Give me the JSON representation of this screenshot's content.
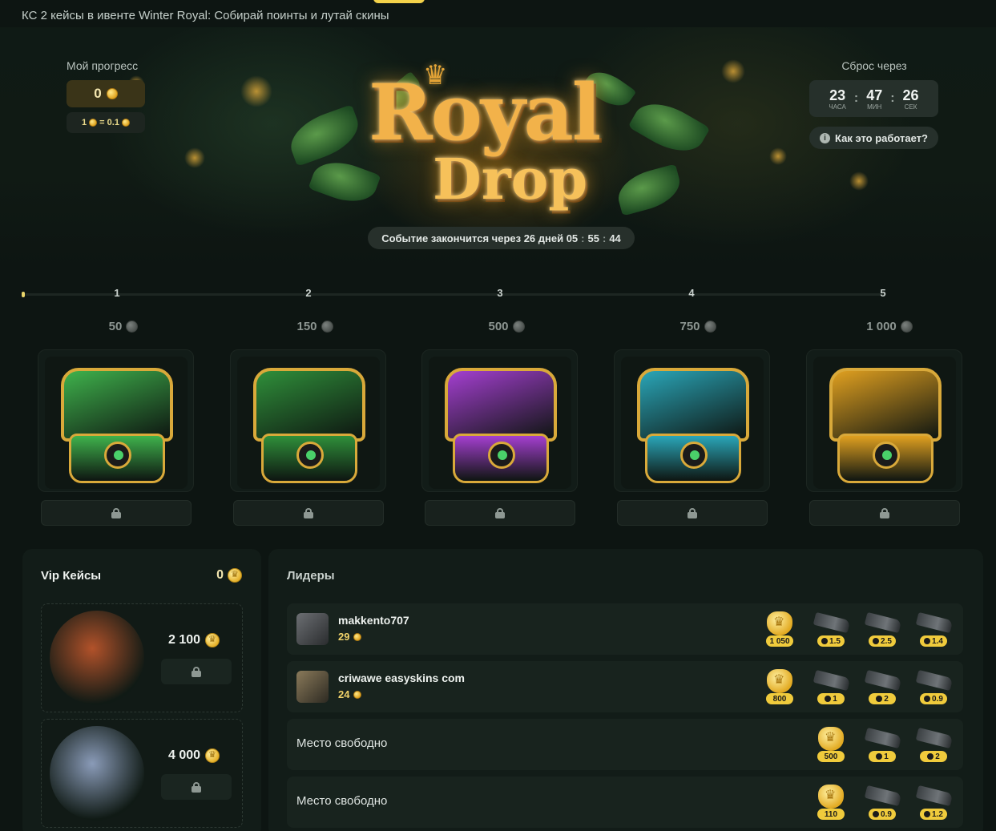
{
  "page": {
    "title": "КС 2 кейсы в ивенте Winter Royal: Собирай поинты и лутай скины"
  },
  "progress": {
    "label": "Мой прогресс",
    "value": "0",
    "rate_left": "1",
    "rate_eq": "= 0.1"
  },
  "logo": {
    "line1": "Royal",
    "line2": "Drop"
  },
  "event": {
    "ends_label": "Событие закончится через 26 дней 05",
    "ends_m": "55",
    "ends_s": "44"
  },
  "reset": {
    "label": "Сброс через",
    "hours": "23",
    "hours_cap": "часа",
    "minutes": "47",
    "minutes_cap": "мин",
    "seconds": "26",
    "seconds_cap": "сек",
    "how_label": "Как это работает?"
  },
  "steps": [
    {
      "num": "1",
      "points": "50",
      "color": "#3fb24c"
    },
    {
      "num": "2",
      "points": "150",
      "color": "#2f8f3a"
    },
    {
      "num": "3",
      "points": "500",
      "color": "#a43fd0"
    },
    {
      "num": "4",
      "points": "750",
      "color": "#2aa6b8"
    },
    {
      "num": "5",
      "points": "1 000",
      "color": "#e0a020"
    }
  ],
  "vip": {
    "title": "Vip Кейсы",
    "count": "0",
    "items": [
      {
        "price": "2 100",
        "color": "#b2522a"
      },
      {
        "price": "4 000",
        "color": "#8a9bb8"
      }
    ]
  },
  "leaders": {
    "title": "Лидеры",
    "rows": [
      {
        "name": "makkento707",
        "score": "29",
        "crown": "1 050",
        "prizes": [
          "1.5",
          "2.5",
          "1.4"
        ]
      },
      {
        "name": "criwawe easyskins com",
        "score": "24",
        "crown": "800",
        "prizes": [
          "1",
          "2",
          "0.9"
        ]
      },
      {
        "free": "Место свободно",
        "crown": "500",
        "prizes": [
          "1",
          "2"
        ]
      },
      {
        "free": "Место свободно",
        "crown": "110",
        "prizes": [
          "0.9",
          "1.2"
        ]
      }
    ]
  }
}
